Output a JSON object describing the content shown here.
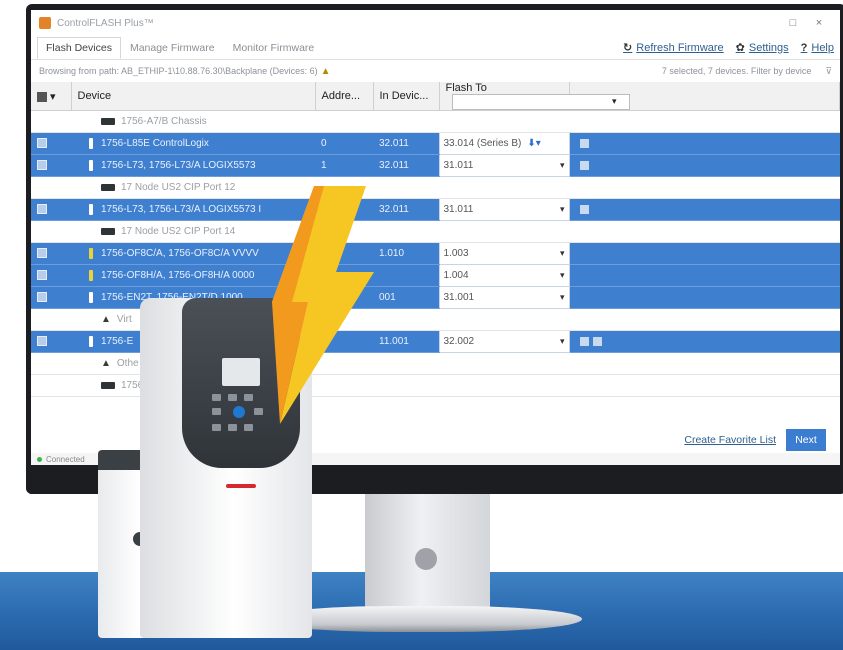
{
  "window": {
    "title": "ControlFLASH Plus™",
    "minimize": "□",
    "close": "×"
  },
  "tabs": [
    {
      "label": "Flash Devices",
      "active": true
    },
    {
      "label": "Manage Firmware",
      "active": false
    },
    {
      "label": "Monitor Firmware",
      "active": false
    }
  ],
  "toolbar": {
    "refresh_label": "Refresh Firmware",
    "settings_label": "Settings",
    "help_label": "Help",
    "refresh_icon": "↻",
    "settings_icon": "✿",
    "help_icon": "?"
  },
  "path": {
    "text": "Browsing from path: AB_ETHIP-1\\10.88.76.30\\Backplane (Devices: 6)",
    "summary": "7 selected, 7 devices. Filter by device",
    "filter_icon": "⊽"
  },
  "table": {
    "columns": [
      "Device",
      "Addre...",
      "In Devic...",
      "Flash To"
    ],
    "rows": [
      {
        "type": "group",
        "device": "1756-A7/B Chassis",
        "icon": "bus"
      },
      {
        "type": "device",
        "selected": true,
        "device": "1756-L85E ControlLogix",
        "address": "0",
        "in_device": "32.011",
        "flash_to": "33.014 (Series B)",
        "download": "⬇▾",
        "extra": "note"
      },
      {
        "type": "device",
        "selected": true,
        "device": "1756-L73, 1756-L73/A LOGIX5573",
        "address": "1",
        "in_device": "32.011",
        "flash_to": "31.011",
        "extra": "people"
      },
      {
        "type": "group",
        "device": "17 Node US2 CIP Port 12",
        "icon": "bus"
      },
      {
        "type": "device",
        "selected": true,
        "device": "1756-L73, 1756-L73/A LOGIX5573 I",
        "address": "",
        "in_device": "32.011",
        "flash_to": "31.011",
        "extra": "people"
      },
      {
        "type": "group",
        "device": "17 Node US2 CIP Port 14",
        "icon": "bus"
      },
      {
        "type": "device",
        "selected": true,
        "yellow": true,
        "device": "1756-OF8C/A, 1756-OF8C/A VVVV",
        "address": "",
        "in_device": "1.010",
        "flash_to": "1.003",
        "extra": ""
      },
      {
        "type": "device",
        "selected": true,
        "yellow": true,
        "device": "1756-OF8H/A, 1756-OF8H/A 0000",
        "address": "",
        "in_device": "",
        "flash_to": "1.004",
        "extra": ""
      },
      {
        "type": "device",
        "selected": true,
        "device": "1756-EN2T, 1756-EN2T/D 1000",
        "address": "",
        "in_device": "001",
        "flash_to": "31.001",
        "extra": ""
      },
      {
        "type": "group",
        "device": "Virt",
        "icon": "net"
      },
      {
        "type": "device",
        "selected": true,
        "device": "1756-E",
        "address": "",
        "in_device": "11.001",
        "flash_to": "32.002",
        "extra": "gear-note"
      },
      {
        "type": "group",
        "device": "Othe",
        "icon": "net"
      },
      {
        "type": "group",
        "device": "1756",
        "icon": "bus"
      }
    ]
  },
  "footer": {
    "create_favorite": "Create Favorite List",
    "next": "Next",
    "status": "Connected"
  },
  "colors": {
    "selected_row": "#3f7fd0",
    "accent": "#3b7dd0",
    "floor": "#2a68ad",
    "bolt": "#f6c623",
    "controller_red": "#d6282d"
  }
}
